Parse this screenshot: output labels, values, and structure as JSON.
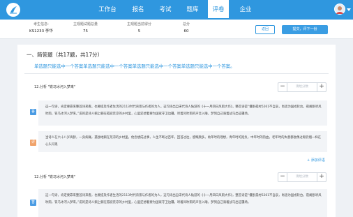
{
  "nav": {
    "items": [
      {
        "label": "工作台",
        "active": false
      },
      {
        "label": "报名",
        "active": false
      },
      {
        "label": "考试",
        "active": false
      },
      {
        "label": "题库",
        "active": false
      },
      {
        "label": "评卷",
        "active": true
      },
      {
        "label": "企业",
        "active": false
      }
    ]
  },
  "info": {
    "examinee_label": "考生信息:",
    "examinee_value": "KS1233 李华",
    "subjective_total_label": "主观题试题总量",
    "subjective_total_value": "75",
    "subjective_score_label": "主观题当前得分",
    "subjective_score_value": "5",
    "total_label": "总分",
    "total_value": "60",
    "return_button": "返回",
    "submit_button": "提交，评下一份"
  },
  "section": {
    "title": "一、简答题（共17题，共17分）",
    "desc": "单选题只能选中一个答案单选题只能选中一个答案单选题只能选中一个答案单选题只能选中一个答案。"
  },
  "questions": [
    {
      "title": "12.分析",
      "quote": "\"铁马冰河入梦来\"",
      "score_placeholder": "请给分数",
      "answer_tag": "答",
      "answer": "这一句诗，肯定要靠来整首诗来看，也要提及作者生活的2113时代背景与作者的为人，这句诗出自宋代诗人陆游的《十一月四日风雨大作》，整首诗是“僵卧孤村5261不自哀，尚思为国戍轮台。夜阑卧听风吹雨，铁马冰河入梦来。”说的是诗人躺上躺在孤寂荒凉的乡村里，心里还想着要为国家守卫边疆。听着风吹雨的声音入睡，梦到自己骑着战马出征疆场。",
      "comment_tag": "评",
      "comment": "当诗人在六十八岁高龄，一身病痛，孤独地躺在荒凉的乡村里。他念想成过事，人生不断过百年，回首过往，感慨颇多。幼年时的理想，青年时的抱负，中年时的热血，老年时的失意都会像过眼云烟一样在心头闪现"
    },
    {
      "title": "12.分析",
      "quote": "\"铁马冰河入梦来\"",
      "score_placeholder": "请给分数",
      "answer_tag": "答",
      "answer": "这一句诗，肯定要靠来整首诗来看，也要提及作者生活的2113时代背景与作者的为人，这句诗出自宋代诗人陆游的《十一月四日风雨大作》，整首诗是“僵卧孤村5261不自哀，尚思为国戍轮台。夜阑卧听风吹雨，铁马冰河入梦来。”说的是诗人躺上躺在孤寂荒凉的乡村里，心里还想着要为国家守卫边疆。听着风吹雨的声音入睡，梦到自己骑着战马出征疆场。"
    }
  ],
  "add_comment": "+ 添加评语",
  "colors": {
    "primary": "#2f97df",
    "answer_tag": "#4a9be3",
    "comment_tag": "#f0a26a"
  }
}
